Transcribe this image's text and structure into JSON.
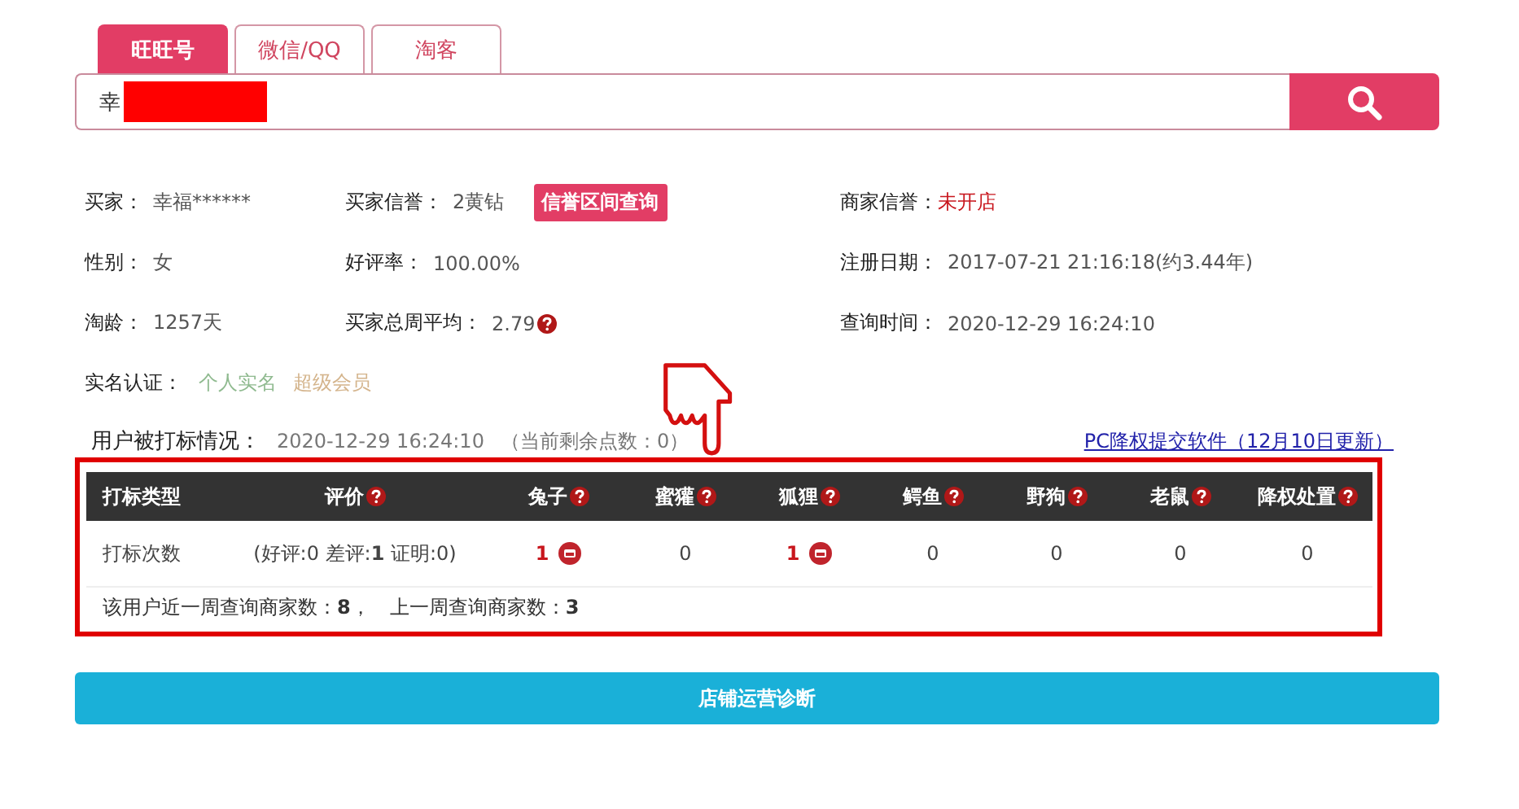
{
  "tabs": [
    {
      "label": "旺旺号",
      "selected": true
    },
    {
      "label": "微信/QQ",
      "selected": false
    },
    {
      "label": "淘客",
      "selected": false
    }
  ],
  "search": {
    "value": "幸",
    "redacted": true
  },
  "info": [
    {
      "label": "买家：",
      "value": "幸福******",
      "alert": false
    },
    {
      "label": "买家信誉：",
      "value": "2黄钻",
      "button": "信誉区间查询",
      "alert": false
    },
    {
      "label": "商家信誉：",
      "value": "未开店",
      "alert": true
    },
    {
      "label": "性别：",
      "value": "女",
      "alert": false
    },
    {
      "label": "好评率：",
      "value": "100.00%",
      "alert": false
    },
    {
      "label": "注册日期：",
      "value": "2017-07-21 21:16:18(约3.44年)",
      "alert": false
    },
    {
      "label": "淘龄：",
      "value": "1257天",
      "alert": false
    },
    {
      "label": "买家总周平均：",
      "value": "2.79",
      "help": true,
      "alert": false
    },
    {
      "label": "查询时间：",
      "value": "2020-12-29 16:24:10",
      "alert": false
    }
  ],
  "verification": {
    "label": "实名认证：",
    "tags": [
      {
        "text": "个人实名",
        "color": "#8fba8f"
      },
      {
        "text": "超级会员",
        "color": "#d4b48c"
      }
    ]
  },
  "marking": {
    "title": "用户被打标情况：",
    "time": "2020-12-29 16:24:10",
    "points": "（当前剩余点数：0）",
    "link": "PC降权提交软件（12月10日更新）",
    "columns": [
      {
        "label": "打标类型"
      },
      {
        "label": "评价",
        "help": true
      },
      {
        "label": "兔子",
        "help": true
      },
      {
        "label": "蜜獾",
        "help": true
      },
      {
        "label": "狐狸",
        "help": true
      },
      {
        "label": "鳄鱼",
        "help": true
      },
      {
        "label": "野狗",
        "help": true
      },
      {
        "label": "老鼠",
        "help": true
      },
      {
        "label": "降权处置",
        "help": true
      }
    ],
    "row": {
      "label": "打标次数",
      "review": "(好评:0 差评:**1** 证明:0)",
      "cells": [
        {
          "text": "1",
          "flagged": true
        },
        {
          "text": "0",
          "flagged": false
        },
        {
          "text": "1",
          "flagged": true
        },
        {
          "text": "0",
          "flagged": false
        },
        {
          "text": "0",
          "flagged": false
        },
        {
          "text": "0",
          "flagged": false
        },
        {
          "text": "0",
          "flagged": false
        }
      ]
    },
    "footer": "该用户近一周查询商家数：**8**，　上一周查询商家数：**3**"
  },
  "diagnose_button": "店铺运营诊断"
}
